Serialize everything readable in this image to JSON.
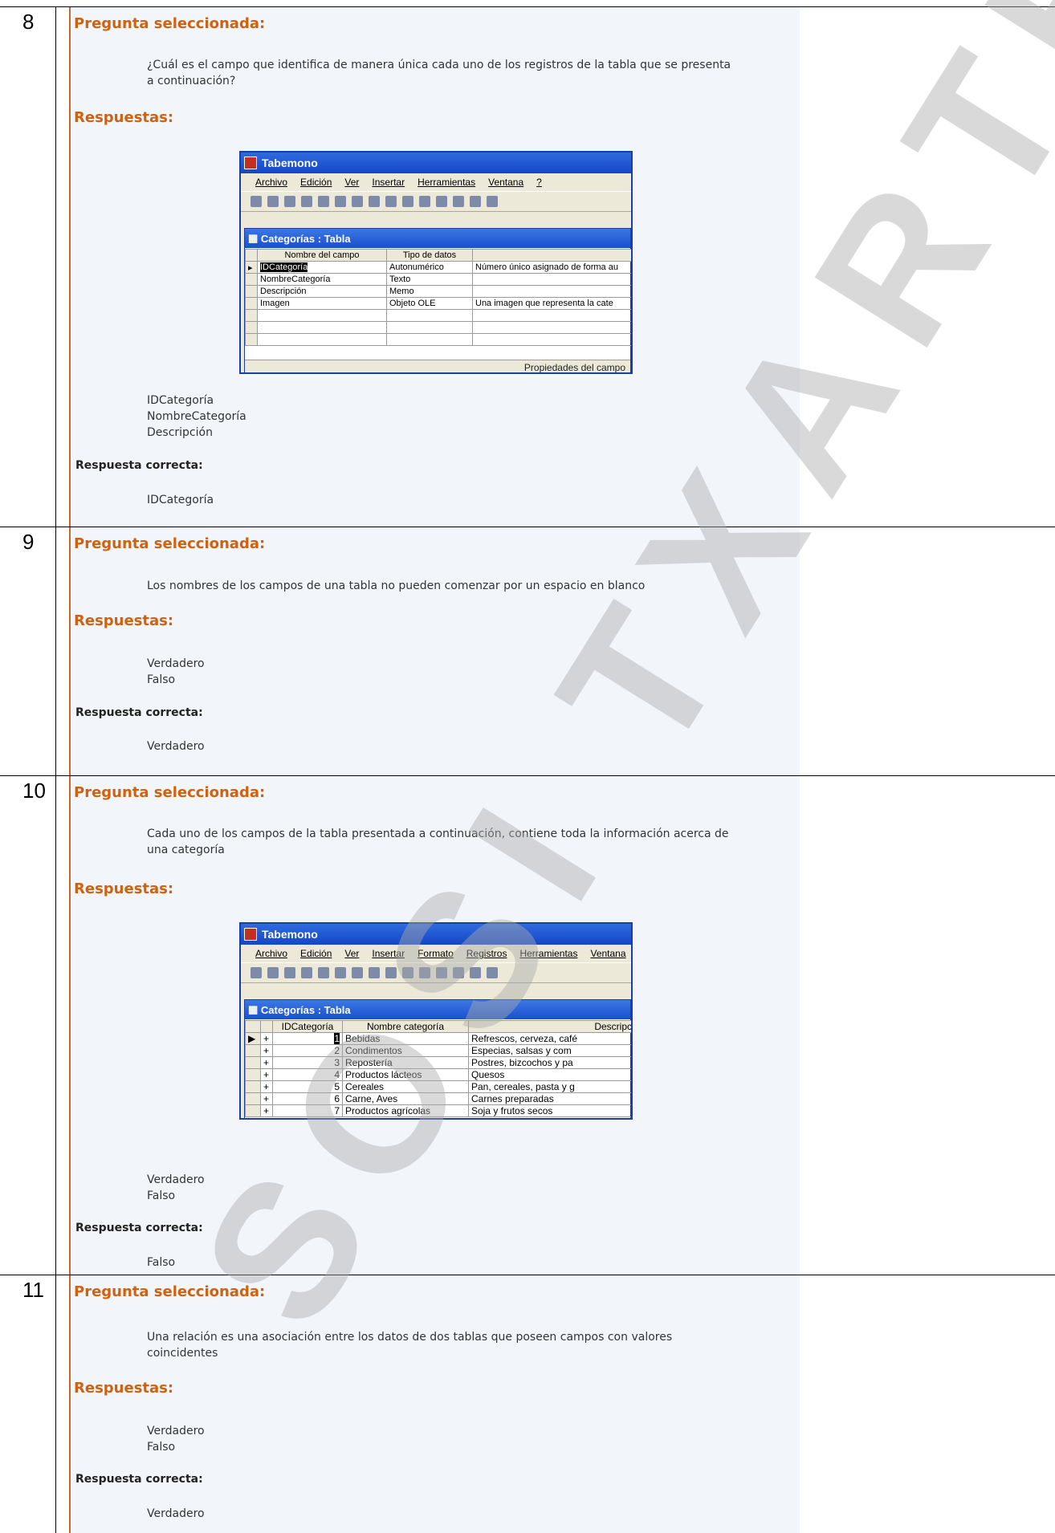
{
  "questions": [
    {
      "num": "8",
      "header": "Pregunta seleccionada:",
      "text1": "¿Cuál es el campo que identifica de manera única cada uno de los registros de la tabla que se presenta",
      "text2": "a continuación?",
      "answers_label": "Respuestas:",
      "options": [
        "IDCategoría",
        "NombreCategoría",
        "Descripción"
      ],
      "correct_label": "Respuesta correcta:",
      "correct": "IDCategoría"
    },
    {
      "num": "9",
      "header": "Pregunta seleccionada:",
      "text1": "Los nombres de los campos de una tabla no pueden comenzar por un espacio en blanco",
      "answers_label": "Respuestas:",
      "options": [
        "Verdadero",
        "Falso"
      ],
      "correct_label": "Respuesta correcta:",
      "correct": "Verdadero"
    },
    {
      "num": "10",
      "header": "Pregunta seleccionada:",
      "text1": "Cada uno de los campos de la tabla presentada a continuación, contiene toda la información acerca de",
      "text2": "una categoría",
      "answers_label": "Respuestas:",
      "options": [
        "Verdadero",
        "Falso"
      ],
      "correct_label": "Respuesta correcta:",
      "correct": "Falso"
    },
    {
      "num": "11",
      "header": "Pregunta seleccionada:",
      "text1": "Una relación es una asociación entre los datos de dos tablas que poseen campos con valores",
      "text2": "coincidentes",
      "answers_label": "Respuestas:",
      "options": [
        "Verdadero",
        "Falso"
      ],
      "correct_label": "Respuesta correcta:",
      "correct": "Verdadero"
    }
  ],
  "window1": {
    "title": "Tabemono",
    "menu": [
      "Archivo",
      "Edición",
      "Ver",
      "Insertar",
      "Herramientas",
      "Ventana",
      "?"
    ],
    "sub_title": "Categorías : Tabla",
    "headers": [
      "Nombre del campo",
      "Tipo de datos",
      ""
    ],
    "rows": [
      [
        "IDCategoría",
        "Autonumérico",
        "Número único asignado de forma au"
      ],
      [
        "NombreCategoría",
        "Texto",
        ""
      ],
      [
        "Descripción",
        "Memo",
        ""
      ],
      [
        "Imagen",
        "Objeto OLE",
        "Una imagen que representa la cate"
      ]
    ],
    "footer": "Propiedades del campo"
  },
  "window2": {
    "title": "Tabemono",
    "menu": [
      "Archivo",
      "Edición",
      "Ver",
      "Insertar",
      "Formato",
      "Registros",
      "Herramientas",
      "Ventana"
    ],
    "sub_title": "Categorías : Tabla",
    "headers": [
      "IDCategoría",
      "Nombre categoría",
      "Descripc"
    ],
    "rows": [
      [
        "1",
        "Bebidas",
        "Refrescos, cerveza, café"
      ],
      [
        "2",
        "Condimentos",
        "Especias, salsas y com"
      ],
      [
        "3",
        "Repostería",
        "Postres, bizcochos y pa"
      ],
      [
        "4",
        "Productos lácteos",
        "Quesos"
      ],
      [
        "5",
        "Cereales",
        "Pan, cereales, pasta y g"
      ],
      [
        "6",
        "Carne, Aves",
        "Carnes preparadas"
      ],
      [
        "7",
        "Productos agrícolas",
        "Soja y frutos secos"
      ]
    ]
  },
  "watermark": "SOSI TXARTELA"
}
